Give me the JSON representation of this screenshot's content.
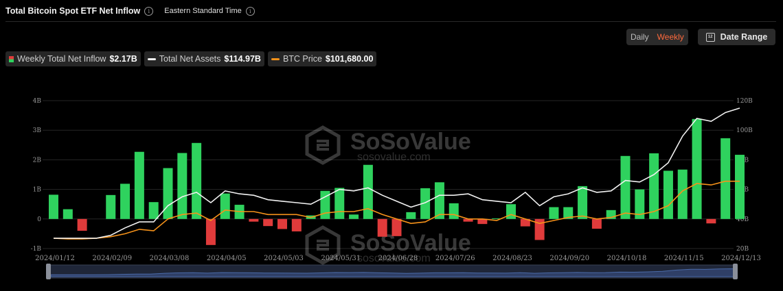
{
  "header": {
    "title": "Total Bitcoin Spot ETF Net Inflow",
    "timezone": "Eastern Standard Time"
  },
  "controls": {
    "daily_label": "Daily",
    "weekly_label": "Weekly",
    "date_range_label": "Date Range",
    "calendar_glyph": "12"
  },
  "legend": {
    "inflow_label": "Weekly Total Net Inflow",
    "inflow_value": "$2.17B",
    "assets_label": "Total Net Assets",
    "assets_value": "$114.97B",
    "price_label": "BTC Price",
    "price_value": "$101,680.00"
  },
  "watermark": {
    "brand": "SoSoValue",
    "url": "sosovalue.com"
  },
  "colors": {
    "positive": "#2fd25e",
    "negative": "#e03b3b",
    "assets_line": "#f2f2f2",
    "price_line": "#f7931a",
    "accent": "#ff6a3d"
  },
  "chart_data": {
    "type": "bar",
    "title": "Total Bitcoin Spot ETF Net Inflow",
    "left_axis": {
      "range": [
        -1,
        4
      ],
      "tick_labels": [
        "-1B",
        "0",
        "1B",
        "2B",
        "3B",
        "4B"
      ],
      "tick_values": [
        -1,
        0,
        1,
        2,
        3,
        4
      ]
    },
    "right_axis": {
      "range": [
        20,
        120
      ],
      "tick_labels": [
        "20B",
        "40B",
        "60B",
        "80B",
        "100B",
        "120B"
      ],
      "tick_values": [
        20,
        40,
        60,
        80,
        100,
        120
      ]
    },
    "x_tick_labels": [
      "2024/01/12",
      "2024/02/09",
      "2024/03/08",
      "2024/04/05",
      "2024/05/03",
      "2024/05/31",
      "2024/06/28",
      "2024/07/26",
      "2024/08/23",
      "2024/09/20",
      "2024/10/18",
      "2024/11/15",
      "2024/12/13"
    ],
    "x_tick_index": [
      0,
      4,
      8,
      12,
      16,
      20,
      24,
      28,
      32,
      36,
      40,
      44,
      48
    ],
    "grid": true,
    "series": [
      {
        "name": "Weekly Total Net Inflow",
        "axis": "left",
        "kind": "bar",
        "values": [
          0.82,
          0.33,
          -0.4,
          0.0,
          0.81,
          1.19,
          2.27,
          0.57,
          1.72,
          2.23,
          2.57,
          -0.88,
          0.86,
          0.48,
          -0.09,
          -0.24,
          -0.34,
          -0.42,
          0.12,
          0.95,
          1.05,
          0.15,
          1.83,
          -0.6,
          -0.58,
          0.23,
          1.04,
          1.24,
          0.53,
          -0.09,
          -0.17,
          0.02,
          0.5,
          -0.25,
          -0.71,
          0.4,
          0.4,
          1.11,
          -0.33,
          0.3,
          2.13,
          1.0,
          2.22,
          1.63,
          1.67,
          3.38,
          -0.15,
          2.73,
          2.17
        ]
      },
      {
        "name": "Total Net Assets",
        "axis": "right",
        "kind": "line",
        "values": [
          27,
          27,
          27,
          27,
          29,
          34,
          38,
          38,
          49,
          55,
          58,
          51,
          59,
          57,
          56,
          53,
          52,
          51,
          50,
          55,
          60,
          59,
          61,
          56,
          52,
          48,
          51,
          56,
          56,
          57,
          53,
          52,
          51,
          58,
          49,
          55,
          57,
          61,
          58,
          59,
          66,
          65,
          70,
          78,
          96,
          108,
          106,
          112,
          114.97
        ]
      },
      {
        "name": "BTC Price",
        "axis": "right",
        "kind": "line",
        "values": [
          27,
          26.5,
          26.5,
          27,
          28,
          30,
          33,
          32,
          40,
          43,
          44,
          39,
          46,
          45,
          45,
          43,
          43,
          43,
          41,
          44,
          45,
          45,
          47,
          43,
          40,
          37,
          38,
          43,
          43,
          40,
          40,
          39,
          43,
          40,
          37,
          39,
          41,
          42,
          40,
          41,
          44,
          43,
          45,
          49,
          59,
          64,
          63,
          65.5,
          65.5
        ]
      }
    ]
  }
}
